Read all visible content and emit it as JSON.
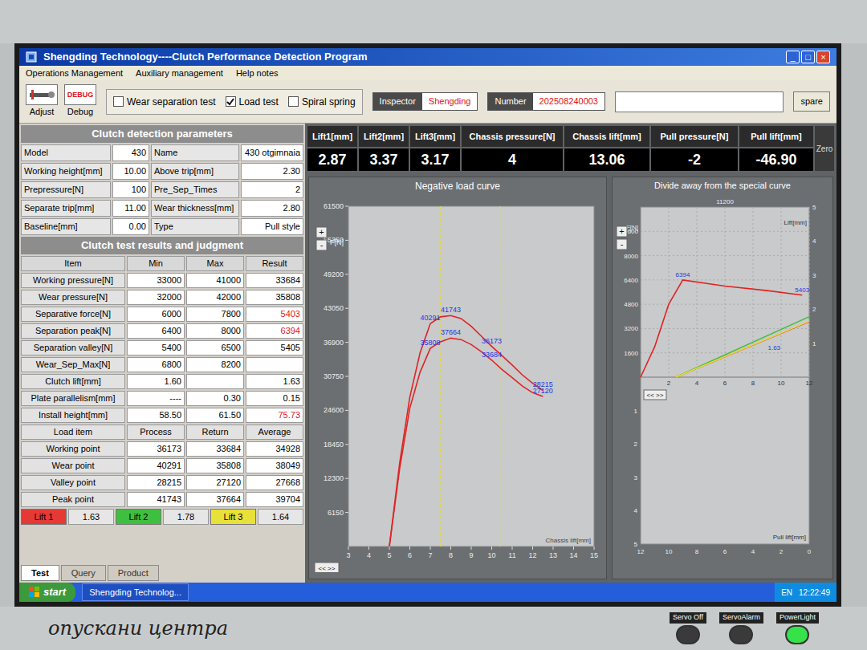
{
  "window": {
    "title": "Shengding Technology----Clutch Performance Detection Program",
    "controls": [
      "_",
      "□",
      "×"
    ]
  },
  "menu": [
    "Operations Management",
    "Auxiliary management",
    "Help notes"
  ],
  "tools": [
    {
      "label": "Adjust",
      "icon_text": ""
    },
    {
      "label": "Debug",
      "icon_text": "DEBUG"
    }
  ],
  "tests": [
    {
      "label": "Wear separation test",
      "checked": false
    },
    {
      "label": "Load test",
      "checked": true
    },
    {
      "label": "Spiral spring",
      "checked": false
    }
  ],
  "inspector": {
    "label": "Inspector",
    "value": "Shengding"
  },
  "number": {
    "label": "Number",
    "value": "202508240003"
  },
  "message": "",
  "spare_button": "spare",
  "params": {
    "title": "Clutch detection parameters",
    "rows": [
      [
        {
          "label": "Model",
          "value": "430"
        },
        {
          "label": "Name",
          "value": "430 otgimnaia"
        }
      ],
      [
        {
          "label": "Working height[mm]",
          "value": "10.00"
        },
        {
          "label": "Above trip[mm]",
          "value": "2.30"
        }
      ],
      [
        {
          "label": "Prepressure[N]",
          "value": "100"
        },
        {
          "label": "Pre_Sep_Times",
          "value": "2"
        }
      ],
      [
        {
          "label": "Separate trip[mm]",
          "value": "11.00"
        },
        {
          "label": "Wear thickness[mm]",
          "value": "2.80"
        }
      ],
      [
        {
          "label": "Baseline[mm]",
          "value": "0.00"
        },
        {
          "label": "Type",
          "value": "Pull style"
        }
      ]
    ]
  },
  "results": {
    "title": "Clutch test results and judgment",
    "columns": [
      "Item",
      "Min",
      "Max",
      "Result"
    ],
    "rows": [
      {
        "kind": "limit",
        "cells": [
          "Working pressure[N]",
          "33000",
          "41000",
          "33684"
        ],
        "fail": false
      },
      {
        "kind": "limit",
        "cells": [
          "Wear pressure[N]",
          "32000",
          "42000",
          "35808"
        ],
        "fail": false
      },
      {
        "kind": "limit",
        "cells": [
          "Separative force[N]",
          "6000",
          "7800",
          "5403"
        ],
        "fail": true
      },
      {
        "kind": "limit",
        "cells": [
          "Separation peak[N]",
          "6400",
          "8000",
          "6394"
        ],
        "fail": true
      },
      {
        "kind": "limit",
        "cells": [
          "Separation valley[N]",
          "5400",
          "6500",
          "5405"
        ],
        "fail": false
      },
      {
        "kind": "limit",
        "cells": [
          "Wear_Sep_Max[N]",
          "6800",
          "8200",
          ""
        ],
        "fail": false
      },
      {
        "kind": "limit",
        "cells": [
          "Clutch lift[mm]",
          "1.60",
          "",
          "1.63"
        ],
        "fail": false
      },
      {
        "kind": "limit",
        "cells": [
          "Plate parallelism[mm]",
          "----",
          "0.30",
          "0.15"
        ],
        "fail": false
      },
      {
        "kind": "limit",
        "cells": [
          "Install height[mm]",
          "58.50",
          "61.50",
          "75.73"
        ],
        "fail": true
      },
      {
        "kind": "header",
        "cells": [
          "Load item",
          "Process",
          "Return",
          "Average"
        ],
        "fail": false
      },
      {
        "kind": "load",
        "cells": [
          "Working point",
          "36173",
          "33684",
          "34928"
        ],
        "fail": false
      },
      {
        "kind": "load",
        "cells": [
          "Wear point",
          "40291",
          "35808",
          "38049"
        ],
        "fail": false
      },
      {
        "kind": "load",
        "cells": [
          "Valley point",
          "28215",
          "27120",
          "27668"
        ],
        "fail": false
      },
      {
        "kind": "load",
        "cells": [
          "Peak point",
          "41743",
          "37664",
          "39704"
        ],
        "fail": false
      }
    ]
  },
  "lifts": [
    {
      "label": "Lift 1",
      "value": "1.63",
      "color": "#e53935"
    },
    {
      "label": "Lift 2",
      "value": "1.78",
      "color": "#3fbf3f"
    },
    {
      "label": "Lift 3",
      "value": "1.64",
      "color": "#e8e13a"
    }
  ],
  "bottom_tabs": [
    {
      "label": "Test",
      "selected": true
    },
    {
      "label": "Query",
      "selected": false
    },
    {
      "label": "Product",
      "selected": false
    }
  ],
  "readings": {
    "columns": [
      "Lift1[mm]",
      "Lift2[mm]",
      "Lift3[mm]",
      "Chassis pressure[N]",
      "Chassis lift[mm]",
      "Pull pressure[N]",
      "Pull lift[mm]"
    ],
    "values": [
      "2.87",
      "3.37",
      "3.17",
      "4",
      "13.06",
      "-2",
      "-46.90"
    ],
    "zero": "Zero"
  },
  "load_chart": {
    "title": "Negative load curve",
    "y_label": "F[N]",
    "x_label": "Chassis lift[mm]",
    "y_min": 0,
    "y_ticks": [
      "61500",
      "55350",
      "49200",
      "43050",
      "36900",
      "30750",
      "24600",
      "18450",
      "12300",
      "6150"
    ],
    "x_ticks": [
      "3",
      "4",
      "5",
      "6",
      "7",
      "8",
      "9",
      "10",
      "11",
      "12",
      "13",
      "14",
      "15"
    ],
    "markers": [
      7.5,
      10.4
    ],
    "marker_color": "#e6d84a",
    "series": [
      {
        "name": "Process",
        "color": "#e02424",
        "x": [
          5.0,
          5.5,
          6.0,
          6.5,
          7.0,
          7.5,
          8.0,
          8.5,
          9.0,
          9.5,
          10.0,
          10.5,
          11.0,
          11.5,
          12.0,
          12.5
        ],
        "y": [
          0,
          15000,
          27000,
          35000,
          40291,
          41500,
          41743,
          41200,
          39800,
          38000,
          36173,
          34500,
          32800,
          31000,
          29500,
          28215
        ]
      },
      {
        "name": "Return",
        "color": "#e02424",
        "x": [
          5.0,
          5.5,
          6.0,
          6.5,
          7.0,
          7.5,
          8.0,
          8.5,
          9.0,
          9.5,
          10.0,
          10.5,
          11.0,
          11.5,
          12.0,
          12.5
        ],
        "y": [
          0,
          14000,
          25000,
          31500,
          35808,
          37000,
          37664,
          37400,
          36500,
          35200,
          33684,
          32000,
          30500,
          29000,
          27800,
          27120
        ]
      }
    ],
    "labels": [
      {
        "text": "40291",
        "x": 7.0,
        "y": 40291
      },
      {
        "text": "41743",
        "x": 8.0,
        "y": 41743
      },
      {
        "text": "36173",
        "x": 10.0,
        "y": 36173
      },
      {
        "text": "28215",
        "x": 12.5,
        "y": 28215
      },
      {
        "text": "35808",
        "x": 7.0,
        "y": 35808
      },
      {
        "text": "37664",
        "x": 8.0,
        "y": 37664
      },
      {
        "text": "33684",
        "x": 10.0,
        "y": 33684
      },
      {
        "text": "27120",
        "x": 12.5,
        "y": 27120
      }
    ],
    "zoom": [
      "+",
      "-"
    ],
    "scroll": "<< >>"
  },
  "separation_chart": {
    "title": "Divide away from the special curve",
    "y_label": "F[N]",
    "y_top": "11200",
    "y_ticks": [
      "9600",
      "8000",
      "6400",
      "4800",
      "3200",
      "1600"
    ],
    "x_ticks": [
      "2",
      "4",
      "6",
      "8",
      "10",
      "12"
    ],
    "lift_label": "Lift[mm]",
    "lift_ticks": [
      "1",
      "2",
      "3",
      "4",
      "5"
    ],
    "pull_label": "Pull lift[mm]",
    "pull_ticks": [
      "1",
      "2",
      "3",
      "4",
      "5"
    ],
    "pull_x_ticks": [
      "12",
      "10",
      "8",
      "6",
      "4",
      "2",
      "0"
    ],
    "force": {
      "color": "#e02424",
      "x": [
        0,
        1,
        2,
        3,
        6,
        9,
        11.5
      ],
      "y": [
        0,
        2000,
        4800,
        6394,
        6000,
        5700,
        5403
      ]
    },
    "lift_series": [
      {
        "color": "#e02424",
        "x": [
          2.5,
          12
        ],
        "y": [
          0,
          1.63
        ]
      },
      {
        "color": "#3fbf3f",
        "x": [
          2.5,
          12
        ],
        "y": [
          0,
          1.78
        ]
      },
      {
        "color": "#e8e13a",
        "x": [
          2.5,
          12
        ],
        "y": [
          0,
          1.64
        ]
      }
    ],
    "labels": [
      {
        "text": "6394",
        "axis": "force",
        "x": 3,
        "y": 6394
      },
      {
        "text": "5403",
        "axis": "force",
        "x": 11.5,
        "y": 5403
      },
      {
        "text": "1.63",
        "axis": "lift",
        "x": 9.5,
        "y": 0.7
      }
    ],
    "zoom": [
      "+",
      "-"
    ],
    "scroll": "<< >>"
  },
  "taskbar": {
    "start": "start",
    "task": "Shengding Technolog...",
    "lang": "EN",
    "clock": "12:22:49"
  },
  "bezel": {
    "note": "опускани центра",
    "buttons": [
      {
        "label": "Servo Off",
        "lit": false
      },
      {
        "label": "ServoAlarm",
        "lit": false
      },
      {
        "label": "PowerLight",
        "lit": true
      }
    ]
  }
}
